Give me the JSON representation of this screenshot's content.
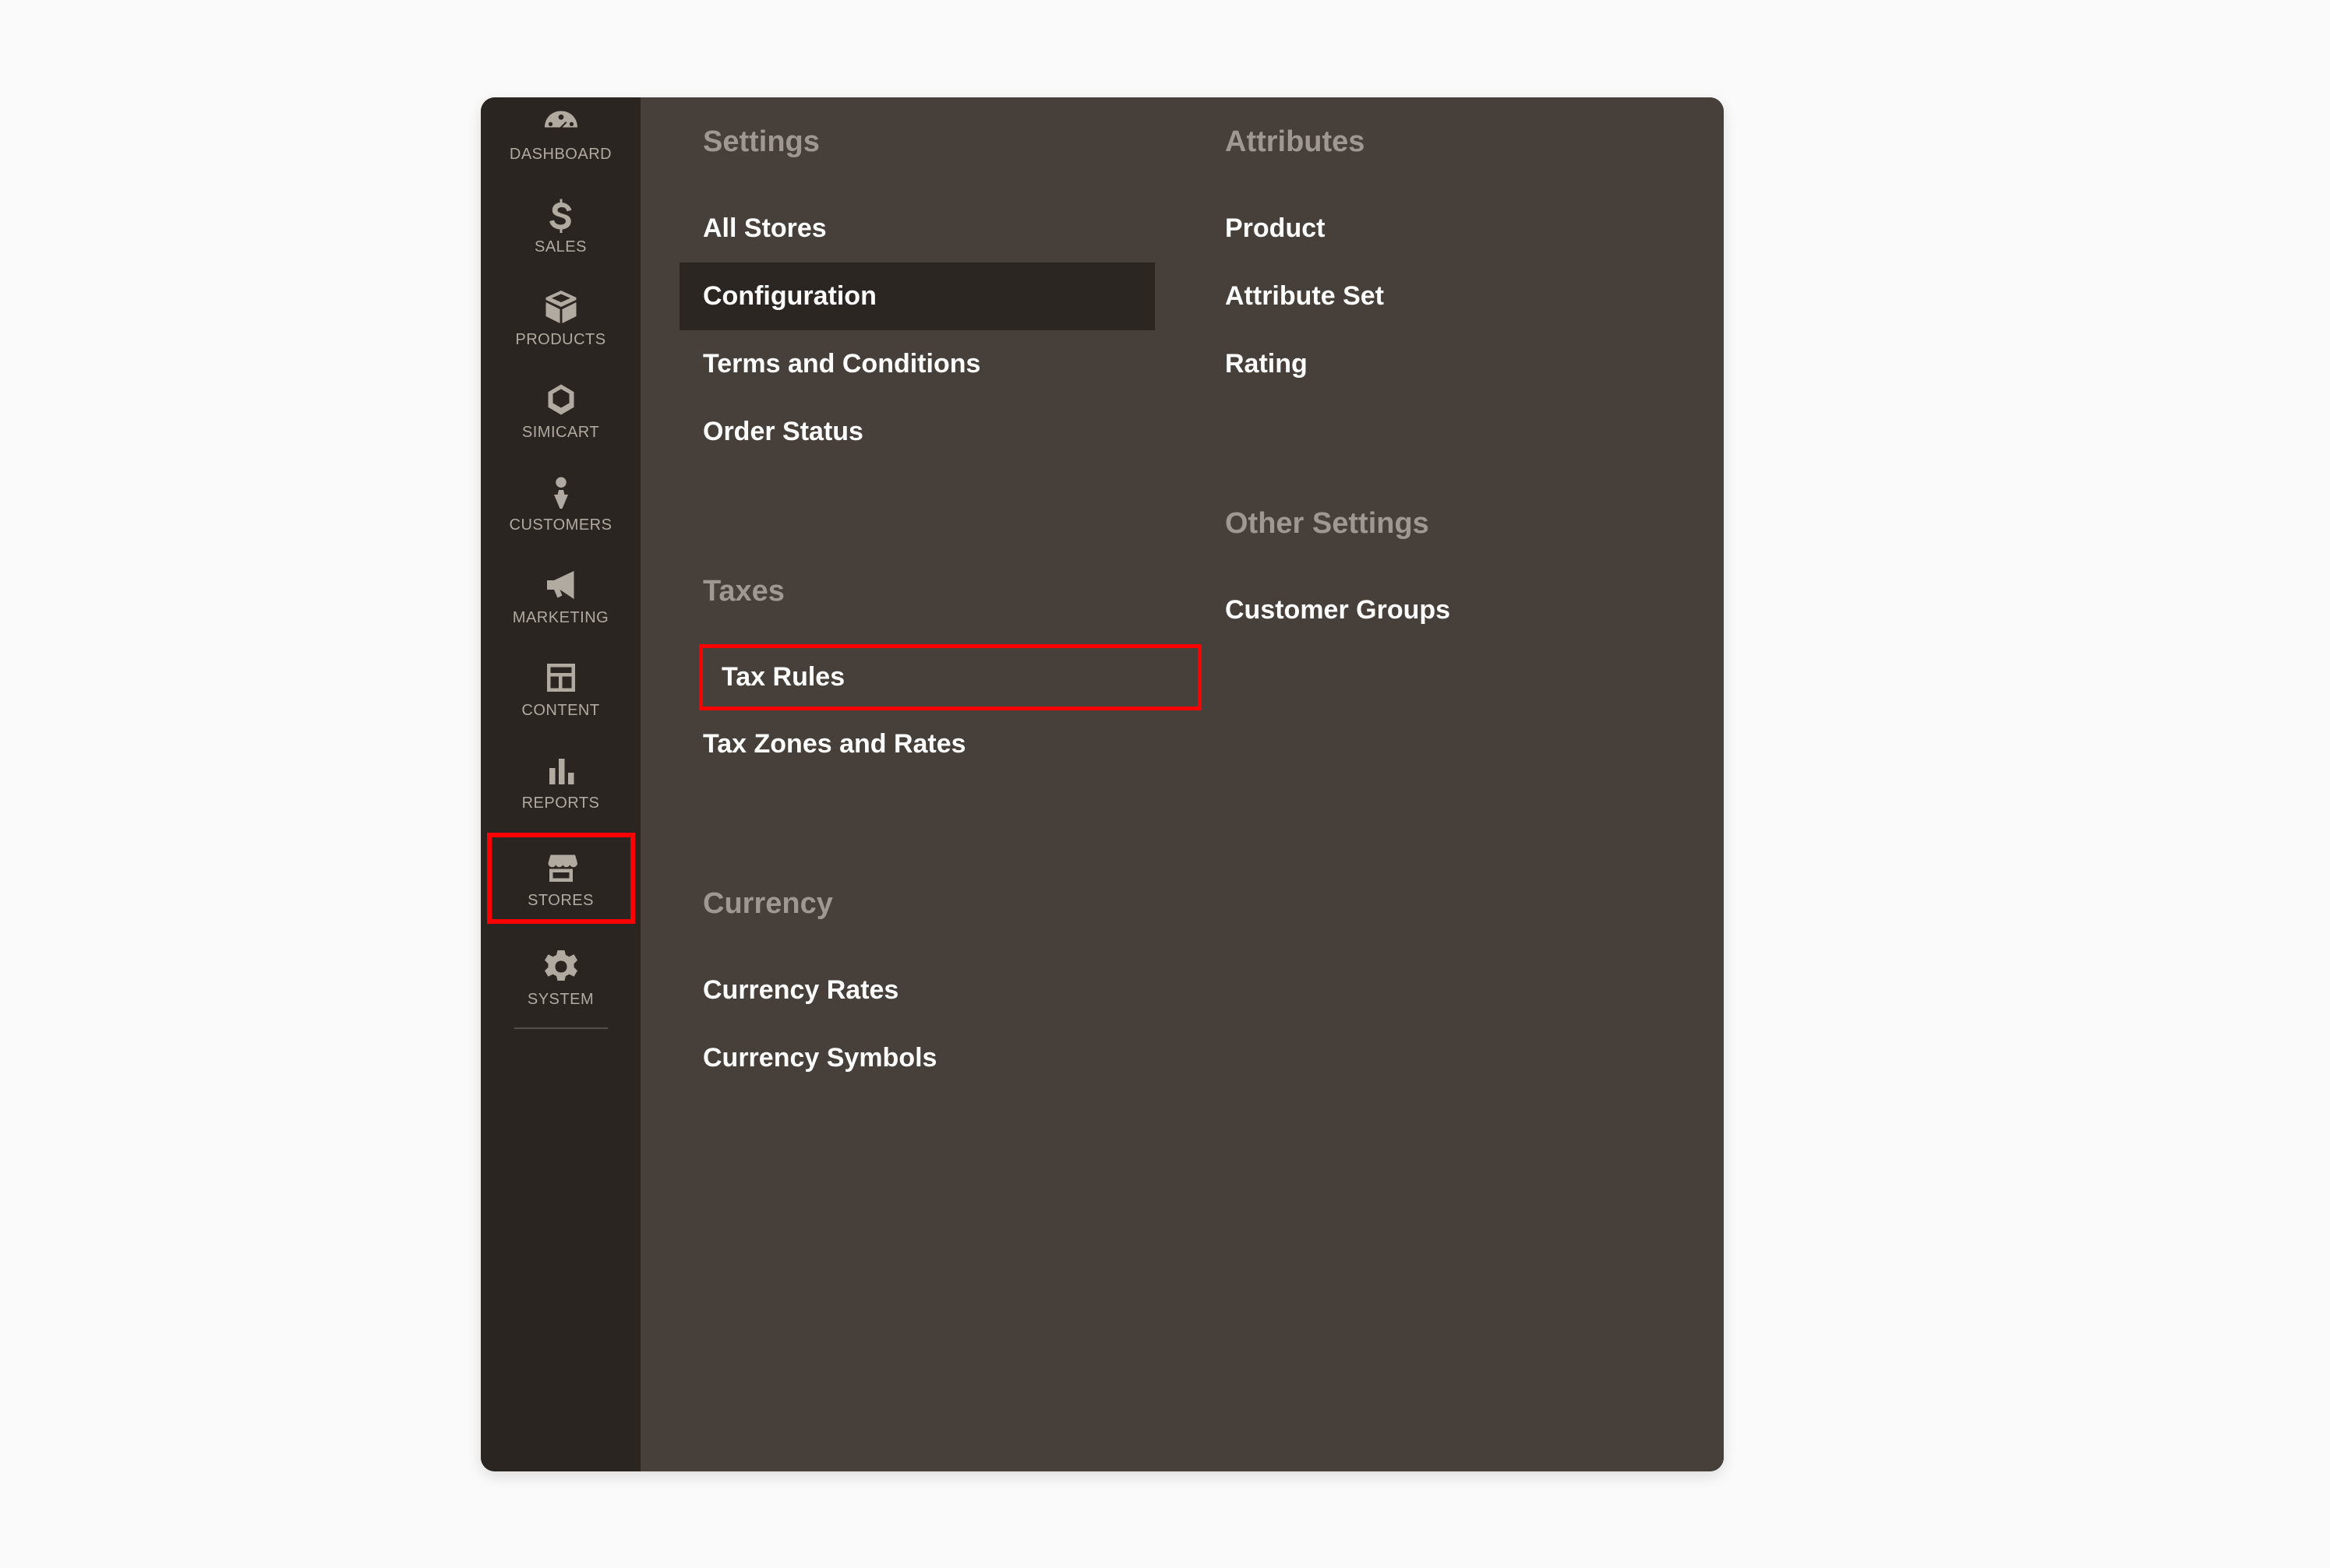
{
  "sidebar": {
    "dashboard": "DASHBOARD",
    "sales": "SALES",
    "products": "PRODUCTS",
    "simicart": "SIMICART",
    "customers": "CUSTOMERS",
    "marketing": "MARKETING",
    "content": "CONTENT",
    "reports": "REPORTS",
    "stores": "STORES",
    "system": "SYSTEM"
  },
  "flyout": {
    "colA": {
      "settings_head": "Settings",
      "all_stores": "All Stores",
      "configuration": "Configuration",
      "terms": "Terms and Conditions",
      "order_status": "Order Status",
      "taxes_head": "Taxes",
      "tax_rules": "Tax Rules",
      "tax_zones": "Tax Zones and Rates",
      "currency_head": "Currency",
      "currency_rates": "Currency Rates",
      "currency_symbols": "Currency Symbols"
    },
    "colB": {
      "attributes_head": "Attributes",
      "product": "Product",
      "attribute_set": "Attribute Set",
      "rating": "Rating",
      "other_head": "Other Settings",
      "customer_groups": "Customer Groups"
    }
  }
}
